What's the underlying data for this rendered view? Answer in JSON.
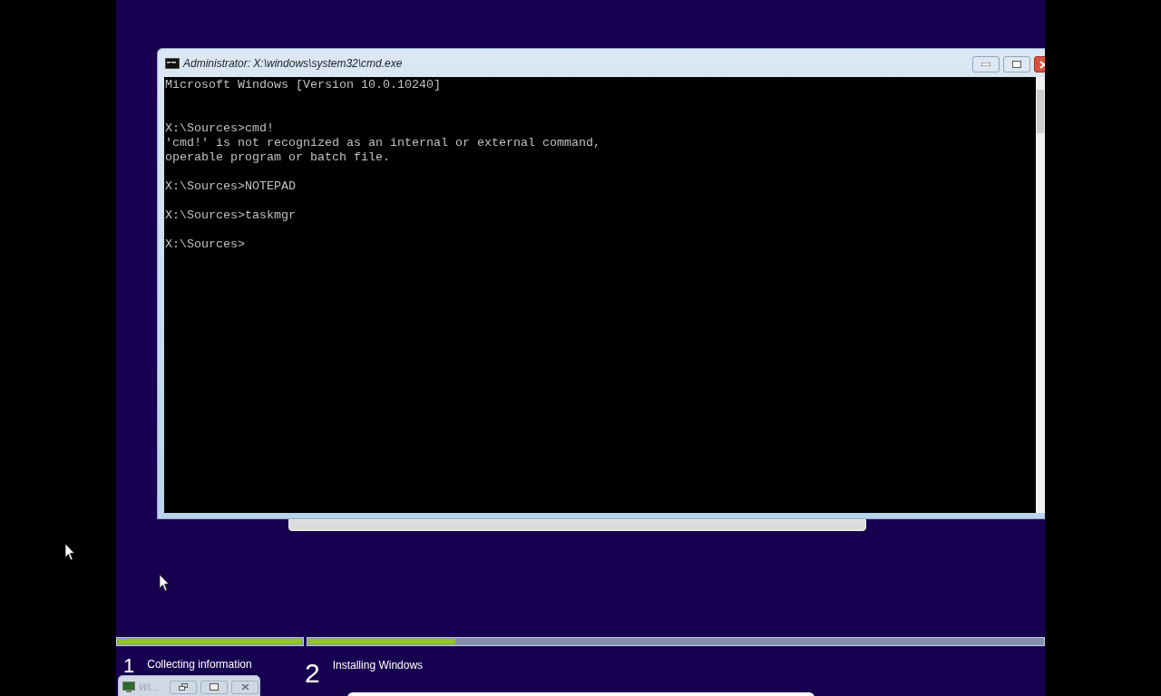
{
  "window": {
    "title": "Administrator: X:\\windows\\system32\\cmd.exe",
    "console_text": "Microsoft Windows [Version 10.0.10240]\n\n\nX:\\Sources>cmd!\n'cmd!' is not recognized as an internal or external command,\noperable program or batch file.\n\nX:\\Sources>NOTEPAD\n\nX:\\Sources>taskmgr\n\nX:\\Sources>"
  },
  "progress": [
    {
      "level": 1
    },
    {
      "level": 0.2
    }
  ],
  "steps": [
    {
      "number": "1",
      "label": "Collecting information"
    },
    {
      "number": "2",
      "label": "Installing Windows"
    }
  ],
  "minimized_window": {
    "title": "Wi..."
  }
}
